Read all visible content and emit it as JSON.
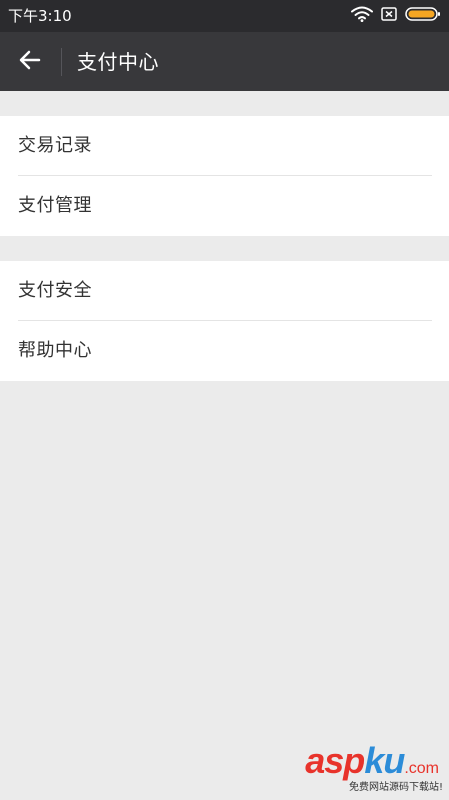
{
  "status_bar": {
    "time": "下午3:10",
    "icons": [
      "wifi-icon",
      "sim-none-icon",
      "battery-icon"
    ],
    "battery_color": "#f5a623"
  },
  "toolbar": {
    "title": "支付中心",
    "back_icon": "arrow-left-icon"
  },
  "groups": [
    {
      "items": [
        {
          "label": "交易记录"
        },
        {
          "label": "支付管理"
        }
      ]
    },
    {
      "items": [
        {
          "label": "支付安全"
        },
        {
          "label": "帮助中心"
        }
      ]
    }
  ],
  "watermark": {
    "brand_part1": "asp",
    "brand_part2": "ku",
    "brand_domain": ".com",
    "subtitle": "免费网站源码下载站!",
    "colors": {
      "red": "#e8332b",
      "blue": "#2c8cd8"
    }
  }
}
